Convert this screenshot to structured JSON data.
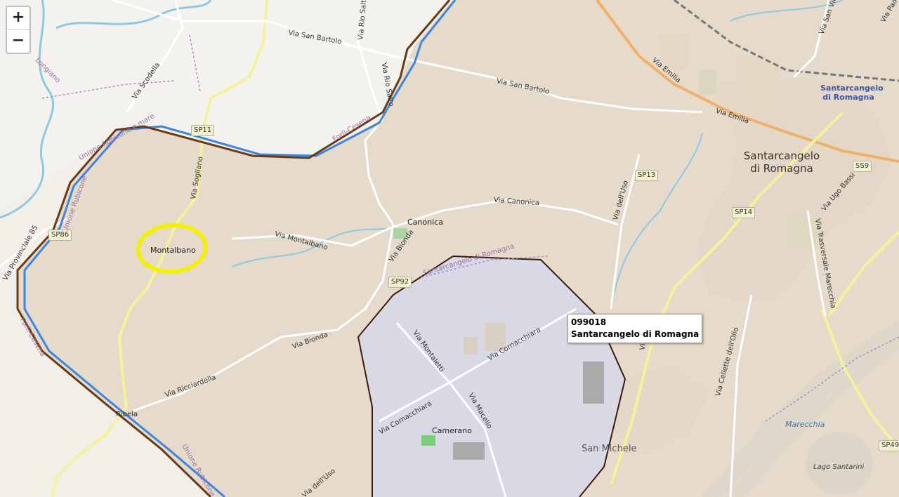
{
  "zoom_controls": {
    "zoom_in": "+",
    "zoom_out": "−"
  },
  "tooltip": {
    "code": "099018",
    "name": "Santarcangelo di Romagna"
  },
  "colors": {
    "land": "#f2efe9",
    "selected_area_fill": "#e4d6c6",
    "highlighted_area_fill": "#d9d9e6",
    "boundary_brown": "#6b3a12",
    "boundary_blue": "#3a86e0",
    "highlight_circle": "#f4f000",
    "highway": "#f0b066",
    "secondary_road": "#f4f29a",
    "river": "#8ec9e4",
    "admin_line": "#a58bc4"
  },
  "labels": {
    "roads": [
      "Via San Bartolo",
      "Via Scodella",
      "Via Rio Salto",
      "Via Rio Salto",
      "Via San Bartolo",
      "Via Emilia",
      "Via Emilia",
      "Via Sogliano",
      "Via Montalbano",
      "Via Bionda",
      "Via Canonica",
      "Via dell'Uso",
      "Via Ugo Bassi",
      "Via Trasversale Marecchia",
      "Via Ricciardella",
      "Via Bionda",
      "Via Montaletti",
      "Via Cornacchiara",
      "Via Cornacchiara",
      "Via Macello",
      "Via Cellette dell'Olio",
      "Via dell'Uso",
      "Via San Vito",
      "Via Pao",
      "Via Sa",
      "Via Provinciale 85"
    ],
    "places": [
      "Montalbano",
      "Canonica",
      "Camerano",
      "San Michele",
      "Ribela",
      "Santarcangelo di Romagna",
      "Santarcangelo di Romagna"
    ],
    "admin": [
      "Forlì-Cesena",
      "Forlì-Cesena",
      "Unione Rubicone e mare",
      "Unione Rubicone",
      "Santarcangelo di Romagna",
      "Longiano",
      "Unione Rubicone"
    ],
    "water": [
      "Marecchia",
      "Lago Santarini"
    ],
    "shields": [
      "SP11",
      "SP13",
      "SP14",
      "SP92",
      "SS9",
      "SP49",
      "SP86"
    ]
  }
}
